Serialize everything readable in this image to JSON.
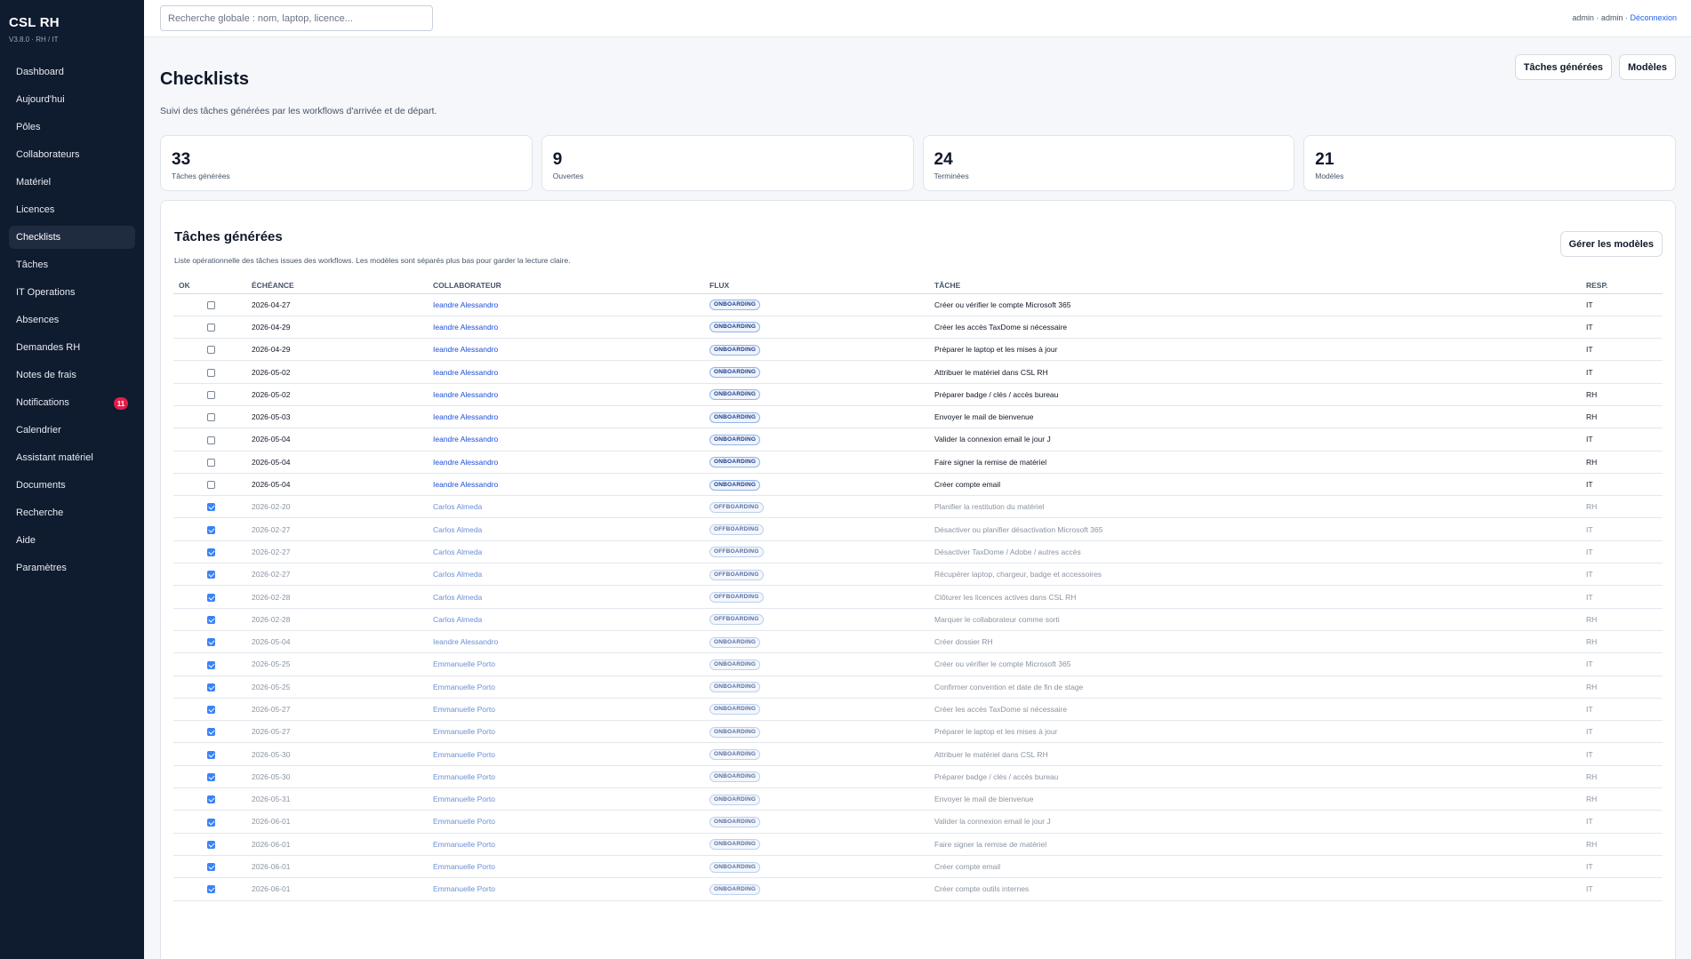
{
  "sidebar": {
    "brand": "CSL RH",
    "version": "V3.8.0 · RH / IT",
    "items": [
      {
        "label": "Dashboard"
      },
      {
        "label": "Aujourd'hui"
      },
      {
        "label": "Pôles"
      },
      {
        "label": "Collaborateurs"
      },
      {
        "label": "Matériel"
      },
      {
        "label": "Licences"
      },
      {
        "label": "Checklists",
        "active": true
      },
      {
        "label": "Tâches"
      },
      {
        "label": "IT Operations"
      },
      {
        "label": "Absences"
      },
      {
        "label": "Demandes RH"
      },
      {
        "label": "Notes de frais"
      },
      {
        "label": "Notifications",
        "badge": "11"
      },
      {
        "label": "Calendrier"
      },
      {
        "label": "Assistant matériel"
      },
      {
        "label": "Documents"
      },
      {
        "label": "Recherche"
      },
      {
        "label": "Aide"
      },
      {
        "label": "Paramètres"
      }
    ]
  },
  "topbar": {
    "search_placeholder": "Recherche globale : nom, laptop, licence...",
    "user": "admin · admin · ",
    "logout": "Déconnexion"
  },
  "page": {
    "title": "Checklists",
    "subtitle": "Suivi des tâches générées par les workflows d'arrivée et de départ.",
    "btn_tasks": "Tâches générées",
    "btn_models": "Modèles"
  },
  "stats": [
    {
      "value": "33",
      "label": "Tâches générées"
    },
    {
      "value": "9",
      "label": "Ouvertes"
    },
    {
      "value": "24",
      "label": "Terminées"
    },
    {
      "value": "21",
      "label": "Modèles"
    }
  ],
  "panel": {
    "title": "Tâches générées",
    "subtitle": "Liste opérationnelle des tâches issues des workflows. Les modèles sont séparés plus bas pour garder la lecture claire.",
    "manage_button": "Gérer les modèles",
    "columns": [
      "OK",
      "ÉCHÉANCE",
      "COLLABORATEUR",
      "FLUX",
      "TÂCHE",
      "RESP."
    ]
  },
  "rows": [
    {
      "done": false,
      "date": "2026-04-27",
      "collab": "Ieandre Alessandro",
      "flux": "ONBOARDING",
      "task": "Créer ou vérifier le compte Microsoft 365",
      "resp": "IT"
    },
    {
      "done": false,
      "date": "2026-04-29",
      "collab": "Ieandre Alessandro",
      "flux": "ONBOARDING",
      "task": "Créer les accès TaxDome si nécessaire",
      "resp": "IT"
    },
    {
      "done": false,
      "date": "2026-04-29",
      "collab": "Ieandre Alessandro",
      "flux": "ONBOARDING",
      "task": "Préparer le laptop et les mises à jour",
      "resp": "IT"
    },
    {
      "done": false,
      "date": "2026-05-02",
      "collab": "Ieandre Alessandro",
      "flux": "ONBOARDING",
      "task": "Attribuer le matériel dans CSL RH",
      "resp": "IT"
    },
    {
      "done": false,
      "date": "2026-05-02",
      "collab": "Ieandre Alessandro",
      "flux": "ONBOARDING",
      "task": "Préparer badge / clés / accès bureau",
      "resp": "RH"
    },
    {
      "done": false,
      "date": "2026-05-03",
      "collab": "Ieandre Alessandro",
      "flux": "ONBOARDING",
      "task": "Envoyer le mail de bienvenue",
      "resp": "RH"
    },
    {
      "done": false,
      "date": "2026-05-04",
      "collab": "Ieandre Alessandro",
      "flux": "ONBOARDING",
      "task": "Valider la connexion email le jour J",
      "resp": "IT"
    },
    {
      "done": false,
      "date": "2026-05-04",
      "collab": "Ieandre Alessandro",
      "flux": "ONBOARDING",
      "task": "Faire signer la remise de matériel",
      "resp": "RH"
    },
    {
      "done": false,
      "date": "2026-05-04",
      "collab": "Ieandre Alessandro",
      "flux": "ONBOARDING",
      "task": "Créer compte email",
      "resp": "IT"
    },
    {
      "done": true,
      "date": "2026-02-20",
      "collab": "Carlos Almeda",
      "flux": "OFFBOARDING",
      "task": "Planifier la restitution du matériel",
      "resp": "RH"
    },
    {
      "done": true,
      "date": "2026-02-27",
      "collab": "Carlos Almeda",
      "flux": "OFFBOARDING",
      "task": "Désactiver ou planifier désactivation Microsoft 365",
      "resp": "IT"
    },
    {
      "done": true,
      "date": "2026-02-27",
      "collab": "Carlos Almeda",
      "flux": "OFFBOARDING",
      "task": "Désactiver TaxDome / Adobe / autres accès",
      "resp": "IT"
    },
    {
      "done": true,
      "date": "2026-02-27",
      "collab": "Carlos Almeda",
      "flux": "OFFBOARDING",
      "task": "Récupérer laptop, chargeur, badge et accessoires",
      "resp": "IT"
    },
    {
      "done": true,
      "date": "2026-02-28",
      "collab": "Carlos Almeda",
      "flux": "OFFBOARDING",
      "task": "Clôturer les licences actives dans CSL RH",
      "resp": "IT"
    },
    {
      "done": true,
      "date": "2026-02-28",
      "collab": "Carlos Almeda",
      "flux": "OFFBOARDING",
      "task": "Marquer le collaborateur comme sorti",
      "resp": "RH"
    },
    {
      "done": true,
      "date": "2026-05-04",
      "collab": "Ieandre Alessandro",
      "flux": "ONBOARDING",
      "task": "Créer dossier RH",
      "resp": "RH"
    },
    {
      "done": true,
      "date": "2026-05-25",
      "collab": "Emmanuelle Porto",
      "flux": "ONBOARDING",
      "task": "Créer ou vérifier le compte Microsoft 365",
      "resp": "IT"
    },
    {
      "done": true,
      "date": "2026-05-25",
      "collab": "Emmanuelle Porto",
      "flux": "ONBOARDING",
      "task": "Confirmer convention et date de fin de stage",
      "resp": "RH"
    },
    {
      "done": true,
      "date": "2026-05-27",
      "collab": "Emmanuelle Porto",
      "flux": "ONBOARDING",
      "task": "Créer les accès TaxDome si nécessaire",
      "resp": "IT"
    },
    {
      "done": true,
      "date": "2026-05-27",
      "collab": "Emmanuelle Porto",
      "flux": "ONBOARDING",
      "task": "Préparer le laptop et les mises à jour",
      "resp": "IT"
    },
    {
      "done": true,
      "date": "2026-05-30",
      "collab": "Emmanuelle Porto",
      "flux": "ONBOARDING",
      "task": "Attribuer le matériel dans CSL RH",
      "resp": "IT"
    },
    {
      "done": true,
      "date": "2026-05-30",
      "collab": "Emmanuelle Porto",
      "flux": "ONBOARDING",
      "task": "Préparer badge / clés / accès bureau",
      "resp": "RH"
    },
    {
      "done": true,
      "date": "2026-05-31",
      "collab": "Emmanuelle Porto",
      "flux": "ONBOARDING",
      "task": "Envoyer le mail de bienvenue",
      "resp": "RH"
    },
    {
      "done": true,
      "date": "2026-06-01",
      "collab": "Emmanuelle Porto",
      "flux": "ONBOARDING",
      "task": "Valider la connexion email le jour J",
      "resp": "IT"
    },
    {
      "done": true,
      "date": "2026-06-01",
      "collab": "Emmanuelle Porto",
      "flux": "ONBOARDING",
      "task": "Faire signer la remise de matériel",
      "resp": "RH"
    },
    {
      "done": true,
      "date": "2026-06-01",
      "collab": "Emmanuelle Porto",
      "flux": "ONBOARDING",
      "task": "Créer compte email",
      "resp": "IT"
    },
    {
      "done": true,
      "date": "2026-06-01",
      "collab": "Emmanuelle Porto",
      "flux": "ONBOARDING",
      "task": "Créer compte outils internes",
      "resp": "IT"
    }
  ],
  "colors": {
    "sidebar_bg": "#0f1b2e",
    "accent": "#3b82f6",
    "link": "#1d4ed8",
    "badge_red": "#e11d48"
  }
}
